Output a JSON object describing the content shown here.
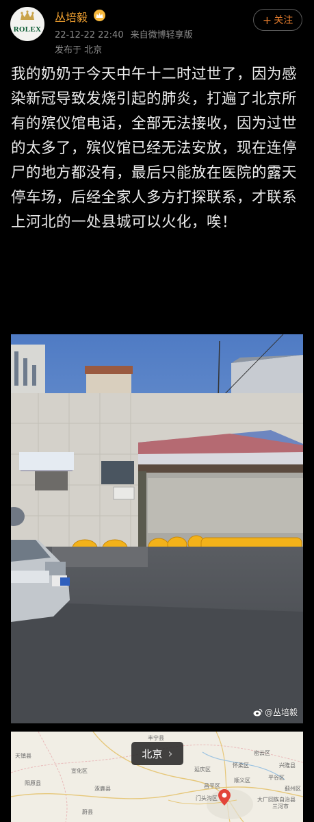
{
  "user": {
    "name": "丛培毅",
    "avatar_text": "ROLEX",
    "badge_color": "#f6b73c",
    "name_color": "#f0a030"
  },
  "post": {
    "time": "22-12-22 22:40",
    "source": "来自微博轻享版",
    "location": "发布于 北京",
    "text": "我的奶奶于今天中午十二时过世了，因为感染新冠导致发烧引起的肺炎，打遍了北京所有的殡仪馆电话，全部无法接收，因为过世的太多了，殡仪馆已经无法安放，现在连停尸的地方都没有，最后只能放在医院的露天停车场，后经全家人多方打探联系，才联系上河北的一处县城可以火化，唉！"
  },
  "follow_button": {
    "label": "关注",
    "plus": "+"
  },
  "photo": {
    "watermark": "@丛培毅",
    "icon": "weibo-icon"
  },
  "map": {
    "place": "北京",
    "arrow": "›",
    "labels": {
      "l1": "丰宁县",
      "l2": "天镇县",
      "l3": "阳原县",
      "l4": "宣化区",
      "l5": "涿鹿县",
      "l6": "延庆区",
      "l7": "怀柔区",
      "l8": "密云区",
      "l9": "兴隆县",
      "l10": "顺义区",
      "l11": "平谷区",
      "l12": "蓟州区",
      "l13": "门头沟区",
      "l14": "大厂回族自治县",
      "l15": "三河市",
      "l16": "昌平区",
      "l17": "蔚县"
    }
  }
}
